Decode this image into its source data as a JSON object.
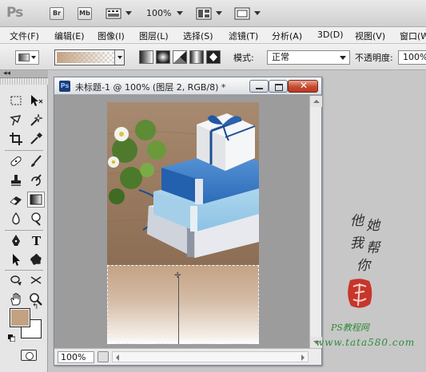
{
  "app": {
    "logo": "Ps",
    "bridge_label": "Br",
    "minibridge_label": "Mb",
    "zoom": "100%",
    "icons": [
      "filmstrip-icon",
      "arrange-documents-icon",
      "screen-mode-icon"
    ]
  },
  "menu": {
    "items": [
      "文件(F)",
      "编辑(E)",
      "图像(I)",
      "图层(L)",
      "选择(S)",
      "滤镜(T)",
      "分析(A)",
      "3D(D)",
      "视图(V)",
      "窗口(W)"
    ]
  },
  "options": {
    "gradient_types": [
      "linear-gradient",
      "radial-gradient",
      "angle-gradient",
      "reflected-gradient",
      "diamond-gradient"
    ],
    "selected_gradient_type": "linear-gradient",
    "mode_label": "模式:",
    "mode_value": "正常",
    "opacity_label": "不透明度:",
    "opacity_value": "100%",
    "gradient_colors": {
      "start": "#c3a283",
      "end": "transparent"
    }
  },
  "toolbox": {
    "collapse_glyph": "◂◂",
    "active_tool": "gradient-tool",
    "tools": [
      "rectangular-marquee-tool",
      "move-tool",
      "lasso-tool",
      "magic-wand-tool",
      "crop-tool",
      "eyedropper-tool",
      "spot-healing-brush-tool",
      "brush-tool",
      "clone-stamp-tool",
      "history-brush-tool",
      "eraser-tool",
      "gradient-tool",
      "blur-tool",
      "dodge-tool",
      "pen-tool",
      "type-tool",
      "path-selection-tool",
      "custom-shape-tool",
      "3d-rotate-tool",
      "3d-orbit-tool",
      "hand-tool",
      "zoom-tool"
    ],
    "foreground_color": "#c3a283",
    "background_color": "#ffffff"
  },
  "document": {
    "title": "未标题-1 @ 100% (图层 2, RGB/8) *",
    "ps_badge": "Ps",
    "zoom": "100%"
  },
  "watermark": {
    "calligraphy": [
      "他",
      "她",
      "我",
      "帮",
      "你"
    ],
    "site": "PS教程网",
    "url": "www.tata580.com"
  }
}
